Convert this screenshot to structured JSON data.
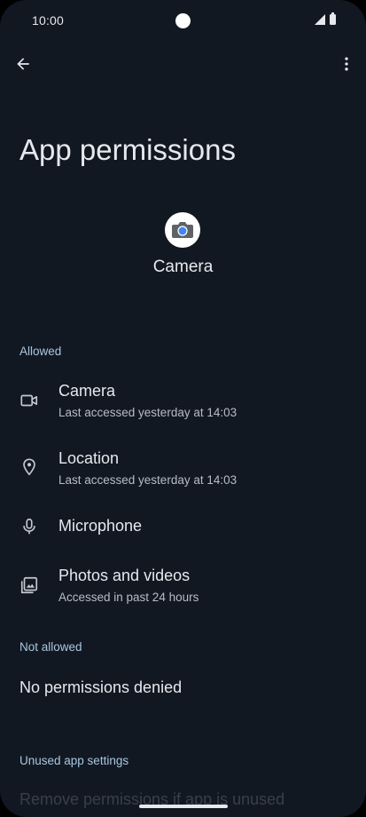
{
  "status_bar": {
    "time": "10:00"
  },
  "page": {
    "title": "App permissions"
  },
  "app": {
    "name": "Camera"
  },
  "sections": {
    "allowed_header": "Allowed",
    "not_allowed_header": "Not allowed",
    "unused_header": "Unused app settings"
  },
  "permissions": [
    {
      "title": "Camera",
      "subtitle": "Last accessed yesterday at 14:03",
      "icon": "videocam-icon"
    },
    {
      "title": "Location",
      "subtitle": "Last accessed yesterday at 14:03",
      "icon": "location-pin-icon"
    },
    {
      "title": "Microphone",
      "subtitle": "",
      "icon": "microphone-icon"
    },
    {
      "title": "Photos and videos",
      "subtitle": "Accessed in past 24 hours",
      "icon": "photos-icon"
    }
  ],
  "not_allowed": {
    "empty_text": "No permissions denied"
  },
  "unused": {
    "partial_text": "Remove permissions if app is unused"
  },
  "colors": {
    "background": "#121821",
    "accent": "#a8c7e3",
    "text_primary": "#e6e8ee",
    "text_secondary": "#b7bcc6"
  }
}
